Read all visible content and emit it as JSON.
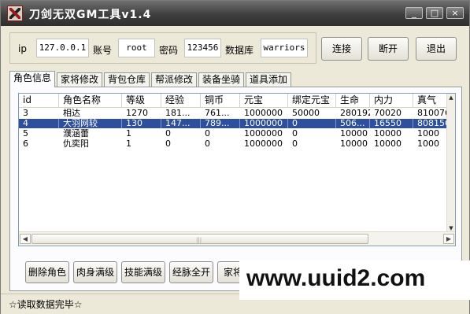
{
  "window": {
    "title": "刀剑无双GM工具v1.4"
  },
  "titlebar_buttons": {
    "minimize": "_",
    "maximize": "□",
    "close": "×"
  },
  "connection": {
    "ip_label": "ip",
    "ip_value": "127.0.0.1",
    "account_label": "账号",
    "account_value": "root",
    "password_label": "密码",
    "password_value": "123456",
    "db_label": "数据库",
    "db_value": "warriors"
  },
  "actions": {
    "connect": "连接",
    "disconnect": "断开",
    "exit": "退出"
  },
  "tabs": [
    {
      "label": "角色信息",
      "active": true
    },
    {
      "label": "家将修改",
      "active": false
    },
    {
      "label": "背包仓库",
      "active": false
    },
    {
      "label": "帮派修改",
      "active": false
    },
    {
      "label": "装备坐骑",
      "active": false
    },
    {
      "label": "道具添加",
      "active": false
    }
  ],
  "grid": {
    "columns": [
      "id",
      "角色名称",
      "等级",
      "经验",
      "铜币",
      "元宝",
      "绑定元宝",
      "生命",
      "内力",
      "真气",
      "-"
    ],
    "rows": [
      {
        "cells": [
          "3",
          "相达",
          "1270",
          "181...",
          "761...",
          "1000000",
          "50000",
          "280192",
          "70020",
          "810076",
          "-"
        ],
        "selected": false
      },
      {
        "cells": [
          "4",
          "大羽网较",
          "130",
          "147...",
          "789...",
          "1000000",
          "0",
          "506...",
          "16550",
          "808156",
          "-"
        ],
        "selected": true
      },
      {
        "cells": [
          "5",
          "濮涵蕾",
          "1",
          "0",
          "0",
          "1000000",
          "0",
          "10000",
          "10000",
          "1000",
          "("
        ],
        "selected": false
      },
      {
        "cells": [
          "6",
          "仇奕阳",
          "1",
          "0",
          "0",
          "1000000",
          "0",
          "10000",
          "10000",
          "1000",
          "("
        ],
        "selected": false
      }
    ],
    "scroll_up": "▲",
    "scroll_down": "▼",
    "scroll_left": "◀",
    "scroll_right": "▶",
    "thumb_grip": "|||"
  },
  "bottom_buttons": [
    "删除角色",
    "肉身满级",
    "技能满级",
    "经脉全开",
    "家将"
  ],
  "status": {
    "text": "☆读取数据完毕☆"
  },
  "watermark": {
    "text": "www.uuid2.com"
  }
}
